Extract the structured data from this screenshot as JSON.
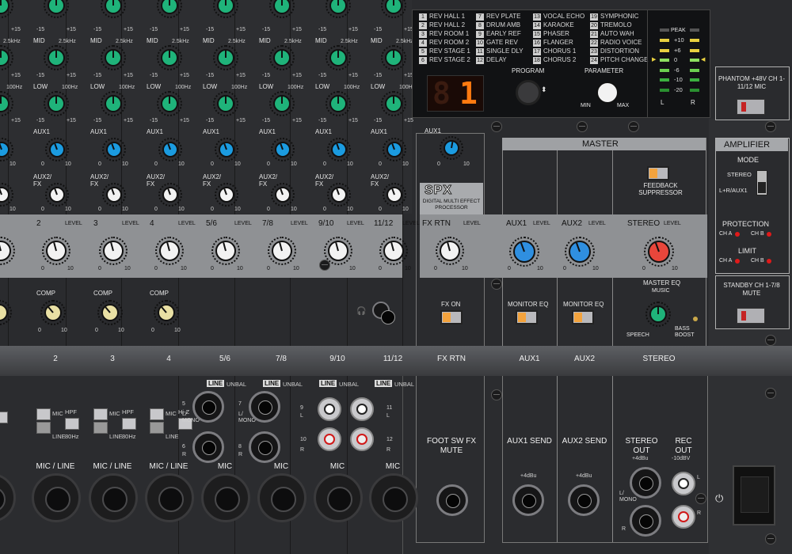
{
  "effects": {
    "programs": [
      {
        "n": "1",
        "name": "REV HALL 1"
      },
      {
        "n": "2",
        "name": "REV HALL 2"
      },
      {
        "n": "3",
        "name": "REV ROOM 1"
      },
      {
        "n": "4",
        "name": "REV ROOM 2"
      },
      {
        "n": "5",
        "name": "REV STAGE 1"
      },
      {
        "n": "6",
        "name": "REV STAGE 2"
      },
      {
        "n": "7",
        "name": "REV PLATE"
      },
      {
        "n": "8",
        "name": "DRUM AMB"
      },
      {
        "n": "9",
        "name": "EARLY REF"
      },
      {
        "n": "10",
        "name": "GATE REV"
      },
      {
        "n": "11",
        "name": "SINGLE DLY"
      },
      {
        "n": "12",
        "name": "DELAY"
      },
      {
        "n": "13",
        "name": "VOCAL ECHO"
      },
      {
        "n": "14",
        "name": "KARAOKE"
      },
      {
        "n": "15",
        "name": "PHASER"
      },
      {
        "n": "16",
        "name": "FLANGER"
      },
      {
        "n": "17",
        "name": "CHORUS 1"
      },
      {
        "n": "18",
        "name": "CHORUS 2"
      },
      {
        "n": "19",
        "name": "SYMPHONIC"
      },
      {
        "n": "20",
        "name": "TREMOLO"
      },
      {
        "n": "21",
        "name": "AUTO WAH"
      },
      {
        "n": "22",
        "name": "RADIO VOICE"
      },
      {
        "n": "23",
        "name": "DISTORTION"
      },
      {
        "n": "24",
        "name": "PITCH CHANGE"
      }
    ],
    "display_value": "1",
    "program_label": "PROGRAM",
    "parameter_label": "PARAMETER",
    "min_label": "MIN",
    "max_label": "MAX",
    "peak_label": "PEAK",
    "meter_scale": [
      "+10",
      "+6",
      "0",
      "-6",
      "-10",
      "-20"
    ],
    "meter_l": "L",
    "meter_r": "R"
  },
  "eq": {
    "mid_label": "MID",
    "low_label": "LOW",
    "mid_freq": "2.5kHz",
    "low_freq": "100Hz",
    "minus15": "-15",
    "plus15": "+15",
    "aux1_label": "AUX1",
    "aux2fx_label": "AUX2/ FX",
    "zero": "0",
    "ten": "10",
    "level_label": "LEVEL",
    "comp_label": "COMP"
  },
  "channels": [
    {
      "num": "2",
      "bottom": "2",
      "mic": "MIC / LINE",
      "hpf": "HPF",
      "hpf_val": "80Hz"
    },
    {
      "num": "3",
      "bottom": "3",
      "mic": "MIC / LINE",
      "hpf": "HPF",
      "hpf_val": "80Hz"
    },
    {
      "num": "4",
      "bottom": "4",
      "mic": "MIC / LINE",
      "hpf": "Hi-Z",
      "hpf_val": ""
    },
    {
      "num": "5/6",
      "bottom": "5/6",
      "mic": "MIC"
    },
    {
      "num": "7/8",
      "bottom": "7/8",
      "mic": "MIC"
    },
    {
      "num": "9/10",
      "bottom": "9/10",
      "mic": "MIC"
    },
    {
      "num": "11/12",
      "bottom": "11/12",
      "mic": "MIC"
    }
  ],
  "inputs": {
    "mic_btn": "MIC",
    "line_btn": "LINE",
    "line_badge": "LINE",
    "unbal": "UNBAL",
    "jack5": "5",
    "jack_l_mono": "L/ MONO",
    "jack6": "6",
    "jack_r": "R",
    "jack7": "7",
    "jack8": "8",
    "rca9": "9",
    "rca10": "10",
    "rca11": "11",
    "rca12": "12",
    "l": "L",
    "r": "R"
  },
  "spx": {
    "logo": "SPX",
    "subtitle": "DIGITAL MULTI EFFECT PROCESSOR",
    "aux1": "AUX1",
    "fx_rtn": "FX RTN",
    "fx_on": "FX ON",
    "bottom_label": "FX RTN",
    "foot_sw": "FOOT SW FX MUTE"
  },
  "master": {
    "title": "MASTER",
    "feedback": "FEEDBACK SUPPRESSOR",
    "aux1": "AUX1",
    "aux2": "AUX2",
    "stereo": "STEREO",
    "monitor_eq": "MONITOR EQ",
    "master_eq": "MASTER EQ",
    "music": "MUSIC",
    "speech": "SPEECH",
    "bass_boost": "BASS BOOST",
    "aux1_send": "AUX1 SEND",
    "aux2_send": "AUX2 SEND",
    "plus4": "+4dBu",
    "stereo_out": "STEREO OUT",
    "rec_out": "REC OUT",
    "minus10": "-10dBV",
    "l_mono": "L/ MONO"
  },
  "amplifier": {
    "phantom": "PHANTOM +48V CH 1-11/12 MIC",
    "title": "AMPLIFIER",
    "mode": "MODE",
    "stereo": "STEREO",
    "lr_aux1": "L+R/AUX1",
    "protection": "PROTECTION",
    "limit": "LIMIT",
    "ch_a": "CH A",
    "ch_b": "CH B",
    "standby": "STANDBY CH 1-7/8 MUTE"
  },
  "colors": {
    "eq_knob": "#1fb37a",
    "aux1_knob": "#1b9be0",
    "comp_knob": "#e9e0a4",
    "master_blue": "#2f8fe0",
    "stereo_red": "#e8463b",
    "display_digit": "#ff7a10"
  }
}
